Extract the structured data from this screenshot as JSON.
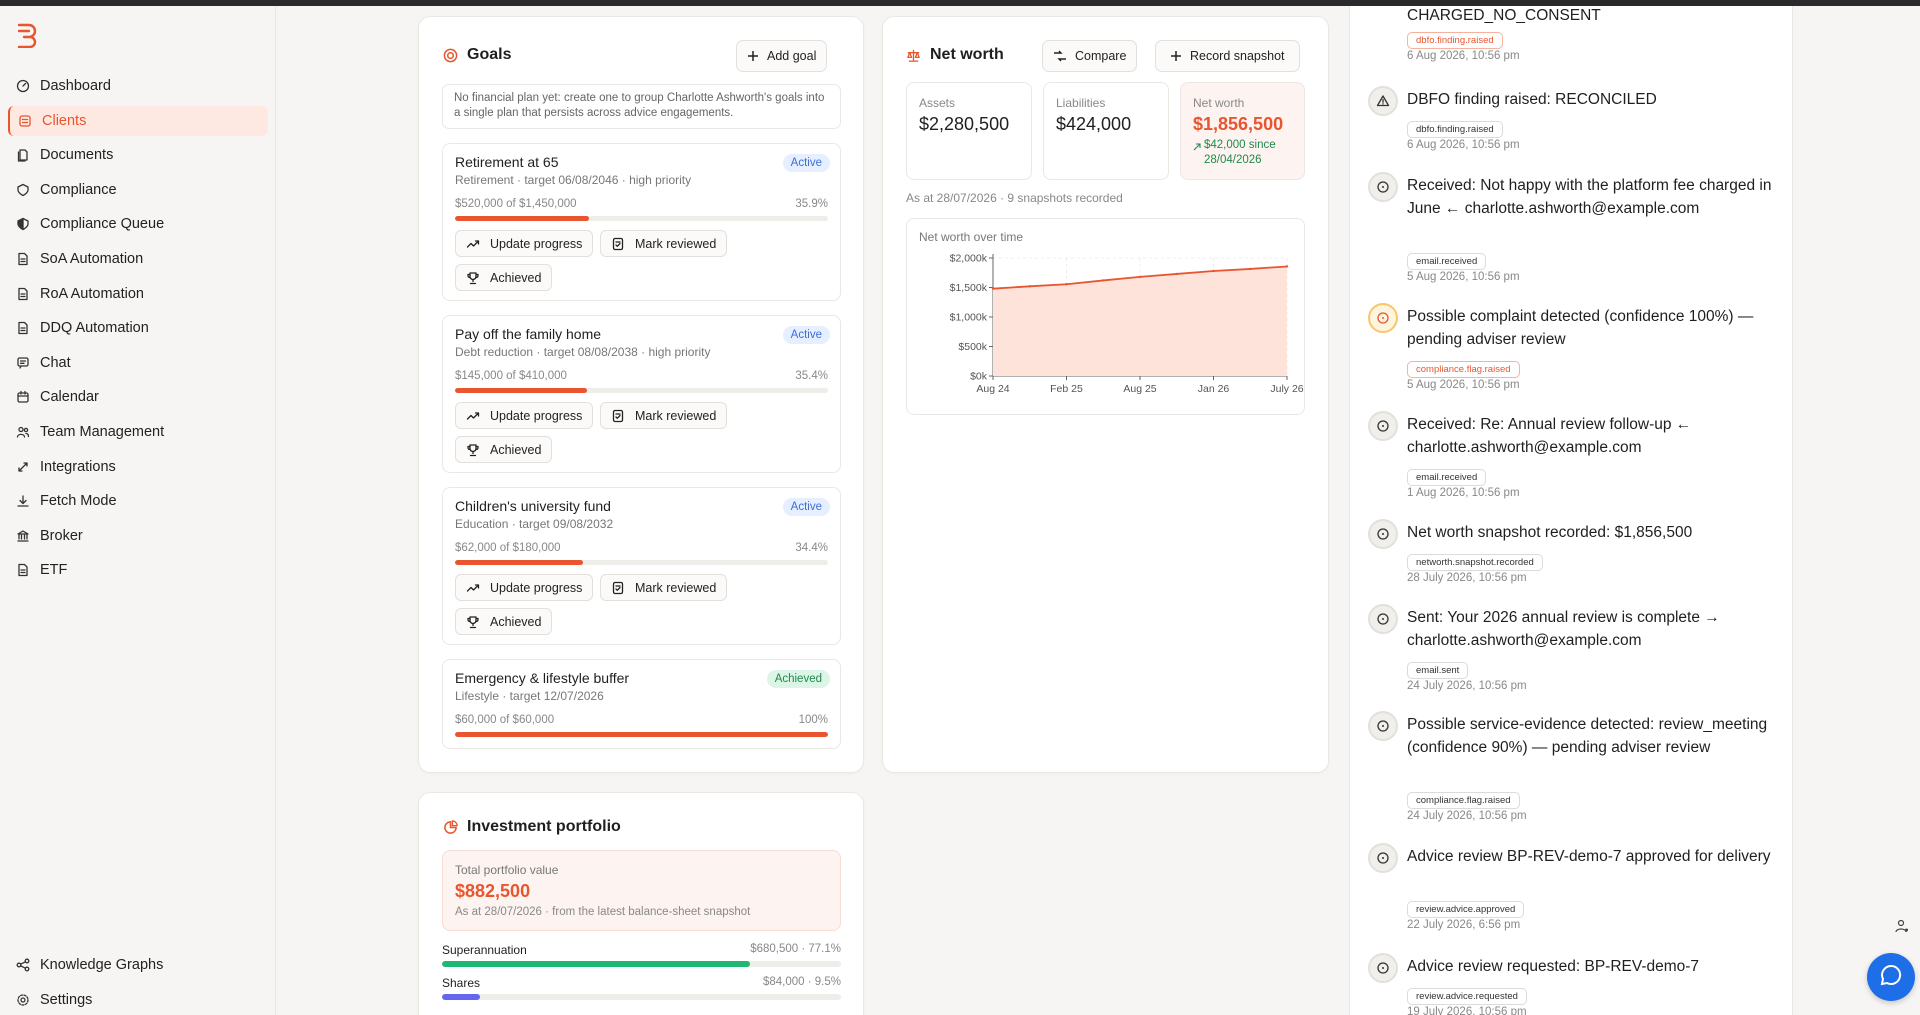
{
  "colors": {
    "accent": "#e8552e",
    "active_badge": "#3d6fd6",
    "achieved_badge": "#1f8a4c",
    "super": "#1fb873",
    "shares": "#6366f1",
    "fab": "#1e6ee8"
  },
  "sidebar": {
    "items": [
      {
        "label": "Dashboard",
        "icon": "dashboard-icon"
      },
      {
        "label": "Clients",
        "icon": "clients-icon",
        "active": true
      },
      {
        "label": "Documents",
        "icon": "documents-icon"
      },
      {
        "label": "Compliance",
        "icon": "compliance-icon"
      },
      {
        "label": "Compliance Queue",
        "icon": "shield-icon"
      },
      {
        "label": "SoA Automation",
        "icon": "document-icon"
      },
      {
        "label": "RoA Automation",
        "icon": "document-icon"
      },
      {
        "label": "DDQ Automation",
        "icon": "document-icon"
      },
      {
        "label": "Chat",
        "icon": "chat-icon"
      },
      {
        "label": "Calendar",
        "icon": "calendar-icon"
      },
      {
        "label": "Team Management",
        "icon": "team-icon"
      },
      {
        "label": "Integrations",
        "icon": "integrations-icon"
      },
      {
        "label": "Fetch Mode",
        "icon": "download-icon"
      },
      {
        "label": "Broker",
        "icon": "bank-icon"
      },
      {
        "label": "ETF",
        "icon": "document-icon"
      }
    ],
    "bottom": [
      {
        "label": "Knowledge Graphs",
        "icon": "graph-icon"
      },
      {
        "label": "Settings",
        "icon": "gear-icon"
      }
    ]
  },
  "goals": {
    "title": "Goals",
    "add_label": "Add goal",
    "note": "No financial plan yet: create one to group Charlotte Ashworth's goals into a single plan that persists across advice engagements.",
    "update_label": "Update progress",
    "review_label": "Mark reviewed",
    "achieved_label": "Achieved",
    "items": [
      {
        "title": "Retirement at 65",
        "sub": "Retirement · target 06/08/2046 · high priority",
        "status": "Active",
        "amount": "$520,000 of $1,450,000",
        "pct": "35.9%",
        "progress": 0.359
      },
      {
        "title": "Pay off the family home",
        "sub": "Debt reduction · target 08/08/2038 · high priority",
        "status": "Active",
        "amount": "$145,000 of $410,000",
        "pct": "35.4%",
        "progress": 0.354
      },
      {
        "title": "Children's university fund",
        "sub": "Education · target 09/08/2032",
        "status": "Active",
        "amount": "$62,000 of $180,000",
        "pct": "34.4%",
        "progress": 0.344
      },
      {
        "title": "Emergency & lifestyle buffer",
        "sub": "Lifestyle · target 12/07/2026",
        "status": "Achieved",
        "amount": "$60,000 of $60,000",
        "pct": "100%",
        "progress": 1.0
      }
    ]
  },
  "networth": {
    "title": "Net worth",
    "compare_label": "Compare",
    "record_label": "Record snapshot",
    "assets_label": "Assets",
    "assets": "$2,280,500",
    "liabilities_label": "Liabilities",
    "liabilities": "$424,000",
    "nw_label": "Net worth",
    "nw": "$1,856,500",
    "delta": "$42,000 since 28/04/2026",
    "as_at": "As at 28/07/2026 · 9 snapshots recorded",
    "chart_title": "Net worth over time"
  },
  "chart_data": {
    "type": "area",
    "title": "Net worth over time",
    "x_ticks": [
      "Aug 24",
      "Feb 25",
      "Aug 25",
      "Jan 26",
      "July 26"
    ],
    "y_ticks": [
      "$0k",
      "$500k",
      "$1,000k",
      "$1,500k",
      "$2,000k"
    ],
    "ylim": [
      0,
      2000
    ],
    "x": [
      "Aug 24",
      "Nov 24",
      "Feb 25",
      "May 25",
      "Aug 25",
      "Nov 25",
      "Jan 26",
      "Apr 26",
      "July 26"
    ],
    "values": [
      1480,
      1520,
      1555,
      1620,
      1680,
      1730,
      1780,
      1815,
      1856.5
    ],
    "grid": true
  },
  "portfolio": {
    "title": "Investment portfolio",
    "total_label": "Total portfolio value",
    "total": "$882,500",
    "as_at": "As at 28/07/2026 · from the latest balance-sheet snapshot",
    "rows": [
      {
        "label": "Superannuation",
        "value": "$680,500 · 77.1%",
        "fraction": 0.771
      },
      {
        "label": "Shares",
        "value": "$84,000 · 9.5%",
        "fraction": 0.095
      }
    ]
  },
  "timeline": {
    "events": [
      {
        "title": "CHARGED_NO_CONSENT",
        "tag": "dbfo.finding.raised",
        "tag_style": "orange",
        "time": "6 Aug 2026, 10:56 pm",
        "icon": "none"
      },
      {
        "title": "DBFO finding raised: RECONCILED",
        "tag": "dbfo.finding.raised",
        "tag_style": "",
        "time": "6 Aug 2026, 10:56 pm",
        "icon": "warning-icon"
      },
      {
        "title": "Received: Not happy with the platform fee charged in June ← charlotte.ashworth@example.com",
        "tag": "email.received",
        "tag_style": "",
        "time": "5 Aug 2026, 10:56 pm",
        "icon": "circle-icon"
      },
      {
        "title": "Possible complaint detected (confidence 100%) — pending adviser review",
        "tag": "compliance.flag.raised",
        "tag_style": "orange",
        "time": "5 Aug 2026, 10:56 pm",
        "icon": "circle-icon",
        "warn": true
      },
      {
        "title": "Received: Re: Annual review follow-up ← charlotte.ashworth@example.com",
        "tag": "email.received",
        "tag_style": "",
        "time": "1 Aug 2026, 10:56 pm",
        "icon": "circle-icon"
      },
      {
        "title": "Net worth snapshot recorded: $1,856,500",
        "tag": "networth.snapshot.recorded",
        "tag_style": "",
        "time": "28 July 2026, 10:56 pm",
        "icon": "circle-icon"
      },
      {
        "title": "Sent: Your 2026 annual review is complete → charlotte.ashworth@example.com",
        "tag": "email.sent",
        "tag_style": "",
        "time": "24 July 2026, 10:56 pm",
        "icon": "circle-icon"
      },
      {
        "title": "Possible service-evidence detected: review_meeting (confidence 90%) — pending adviser review",
        "tag": "compliance.flag.raised",
        "tag_style": "",
        "time": "24 July 2026, 10:56 pm",
        "icon": "circle-icon"
      },
      {
        "title": "Advice review BP-REV-demo-7 approved for delivery",
        "tag": "review.advice.approved",
        "tag_style": "",
        "time": "22 July 2026, 6:56 pm",
        "icon": "circle-icon"
      },
      {
        "title": "Advice review requested: BP-REV-demo-7",
        "tag": "review.advice.requested",
        "tag_style": "",
        "time": "19 July 2026, 10:56 pm",
        "icon": "circle-icon"
      }
    ]
  }
}
